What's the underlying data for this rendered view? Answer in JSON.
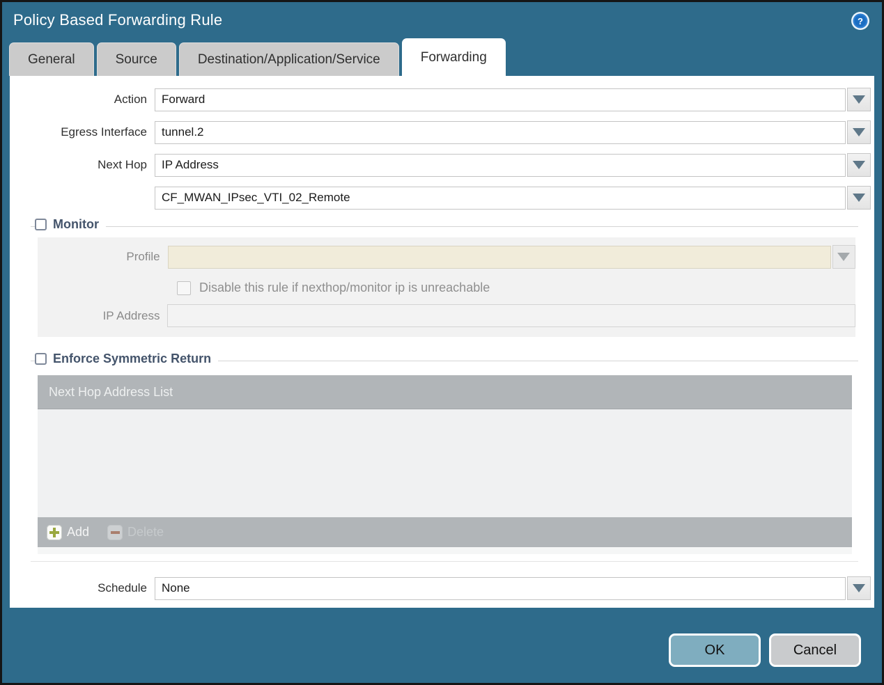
{
  "dialog": {
    "title": "Policy Based Forwarding Rule"
  },
  "tabs": [
    {
      "label": "General",
      "active": false
    },
    {
      "label": "Source",
      "active": false
    },
    {
      "label": "Destination/Application/Service",
      "active": false
    },
    {
      "label": "Forwarding",
      "active": true
    }
  ],
  "form": {
    "action": {
      "label": "Action",
      "value": "Forward"
    },
    "egress_interface": {
      "label": "Egress Interface",
      "value": "tunnel.2"
    },
    "next_hop": {
      "label": "Next Hop",
      "value": "IP Address"
    },
    "next_hop_address": {
      "value": "CF_MWAN_IPsec_VTI_02_Remote"
    },
    "monitor": {
      "legend": "Monitor",
      "checked": false,
      "profile_label": "Profile",
      "profile_value": "",
      "disable_checkbox_label": "Disable this rule if nexthop/monitor ip is unreachable",
      "disable_checkbox_checked": false,
      "ip_address_label": "IP Address",
      "ip_address_value": ""
    },
    "enforce_symmetric_return": {
      "legend": "Enforce Symmetric Return",
      "checked": false,
      "table_header": "Next Hop Address List",
      "rows": [],
      "add_label": "Add",
      "delete_label": "Delete"
    },
    "schedule": {
      "label": "Schedule",
      "value": "None"
    }
  },
  "footer": {
    "ok_label": "OK",
    "cancel_label": "Cancel"
  },
  "colors": {
    "background": "#2e6b8b",
    "ok_button": "#7fadbf",
    "cancel_button": "#c9cbcd",
    "legend_text": "#44546b",
    "disabled_field": "#f1ecda",
    "table_header": "#b1b5b8"
  }
}
